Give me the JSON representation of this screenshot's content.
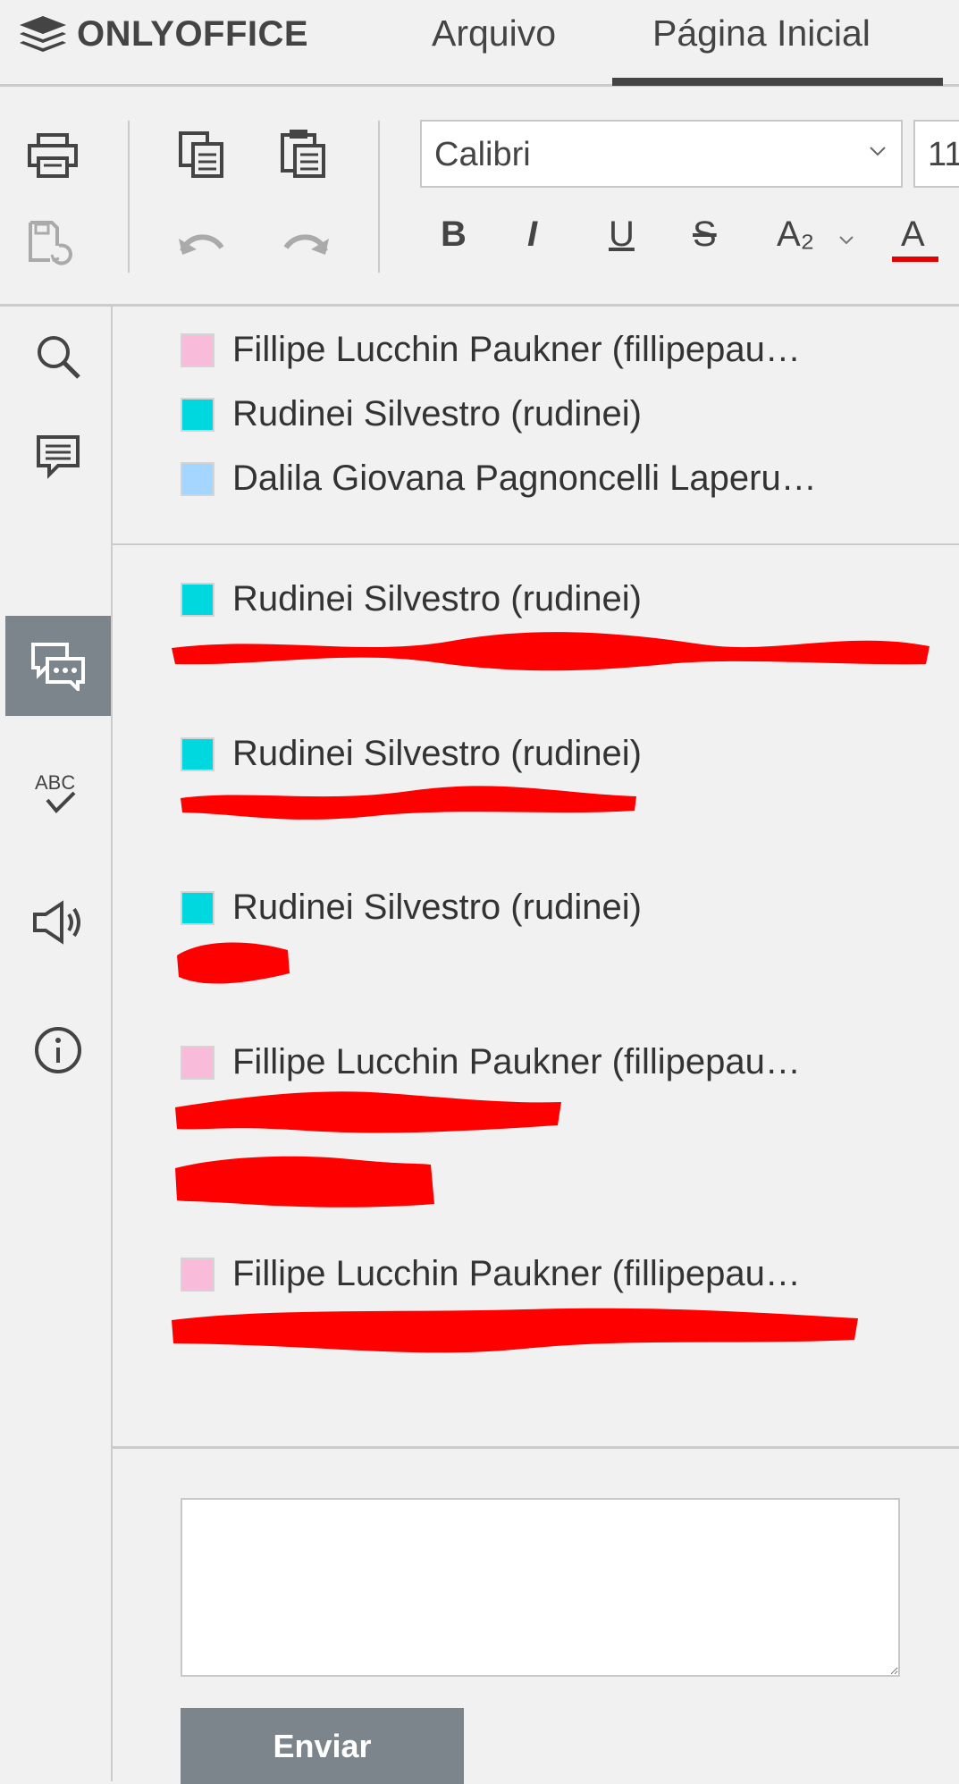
{
  "header": {
    "brand": "ONLYOFFICE",
    "tabs": [
      {
        "label": "Arquivo"
      },
      {
        "label": "Página Inicial"
      }
    ]
  },
  "toolbar": {
    "font_name": "Calibri",
    "font_size": "11",
    "format_buttons": [
      "B",
      "I",
      "U",
      "S",
      "A₂",
      "A"
    ]
  },
  "colors": {
    "background": "#f1f1f1",
    "active_sidebar": "#7d858c",
    "font_color_underline": "#e60000",
    "redaction": "#ff0000",
    "user_pink": "#f8bbd9",
    "user_cyan": "#00d8e0",
    "user_light_blue": "#a5d6ff"
  },
  "users": [
    {
      "name": "Fillipe Lucchin Paukner (fillipepau…",
      "color": "#f8bbd9"
    },
    {
      "name": "Rudinei Silvestro (rudinei)",
      "color": "#00d8e0"
    },
    {
      "name": "Dalila Giovana Pagnoncelli Laperu…",
      "color": "#a5d6ff"
    }
  ],
  "comments": [
    {
      "author": "Rudinei Silvestro (rudinei)",
      "color": "#00d8e0"
    },
    {
      "author": "Rudinei Silvestro (rudinei)",
      "color": "#00d8e0"
    },
    {
      "author": "Rudinei Silvestro (rudinei)",
      "color": "#00d8e0"
    },
    {
      "author": "Fillipe Lucchin Paukner (fillipepau…",
      "color": "#f8bbd9"
    },
    {
      "author": "Fillipe Lucchin Paukner (fillipepau…",
      "color": "#f8bbd9"
    }
  ],
  "reply": {
    "value": "",
    "send_label": "Enviar"
  },
  "icons": {
    "sidebar": [
      "search-icon",
      "comments-icon",
      "chat-icon",
      "spellcheck-icon",
      "feedback-icon",
      "info-icon"
    ]
  }
}
